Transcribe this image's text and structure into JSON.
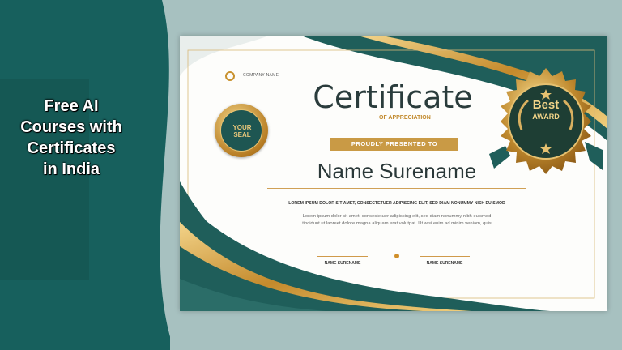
{
  "banner": {
    "title_lines": [
      "Free AI",
      "Courses with",
      "Certificates",
      "in India"
    ]
  },
  "certificate": {
    "company": "COMPANY NAME",
    "title": "Certificate",
    "subtitle": "OF APPRECIATION",
    "presented": "PROUDLY PRESENTED TO",
    "name": "Name Surename",
    "lorem_bold": "LOREM IPSUM DOLOR SIT AMET, CONSECTETUER ADIPISCING ELIT, SED DIAM NONUMMY NISH EUISMOD",
    "lorem_line1": "Lorem ipsum dolor sit amet, consectetuer adipiscing elit, sed diam nonummy nibh euismod",
    "lorem_line2": "tincidunt ut laoreet dolore magna aliquam erat volutpat. Ut wisi enim ad minim veniam, quis",
    "sign_left": "NAME SURENAME",
    "sign_right": "NAME SURENAME",
    "seal_line1": "YOUR",
    "seal_line2": "SEAL",
    "badge_line1": "Best",
    "badge_line2": "AWARD"
  },
  "colors": {
    "teal": "#17605d",
    "gold": "#c99a45",
    "background": "#a7c1c0"
  }
}
